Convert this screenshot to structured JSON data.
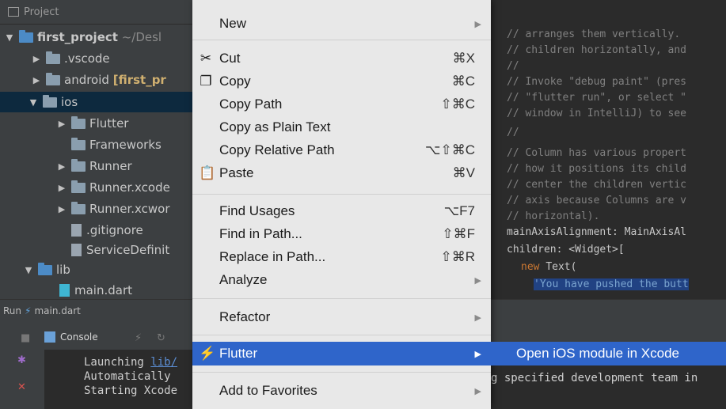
{
  "project": {
    "header": "Project",
    "tree": [
      {
        "name": "first_project",
        "suffix": "~/Desl"
      },
      {
        "name": ".vscode"
      },
      {
        "name": "android",
        "suffix": "[first_pr"
      },
      {
        "name": "ios"
      },
      {
        "name": "Flutter"
      },
      {
        "name": "Frameworks"
      },
      {
        "name": "Runner"
      },
      {
        "name": "Runner.xcode"
      },
      {
        "name": "Runner.xcwor"
      },
      {
        "name": ".gitignore"
      },
      {
        "name": "ServiceDefinit"
      },
      {
        "name": "lib"
      },
      {
        "name": "main.dart"
      }
    ]
  },
  "run_bar": {
    "run": "Run",
    "file": "main.dart"
  },
  "console": {
    "tab": "Console",
    "lines": [
      {
        "text": "Launching ",
        "link": "lib/"
      },
      {
        "text": "Automatically",
        "tail": "g specified development team in"
      },
      {
        "text": "Starting Xcode"
      }
    ]
  },
  "editor": {
    "lines": [
      "// arranges them vertically.",
      "// children horizontally, and",
      "//",
      "// Invoke \"debug paint\" (pres",
      "// \"flutter run\", or select \"",
      "// window in IntelliJ) to see",
      "//",
      "// Column has various propert",
      "// how it positions its child",
      "// center the children vertic",
      "// axis because Columns are v",
      "// horizontal).",
      "mainAxisAlignment: MainAxisAl",
      "children: <Widget>["
    ],
    "kw_new": "new",
    "text_call": "Text(",
    "string": "'You have pushed the butt"
  },
  "context_menu": {
    "items": [
      {
        "label": "New",
        "shortcut": "",
        "submenu": true
      },
      {
        "label": "Cut",
        "shortcut": "⌘X",
        "icon": "✂"
      },
      {
        "label": "Copy",
        "shortcut": "⌘C",
        "icon": "❐"
      },
      {
        "label": "Copy Path",
        "shortcut": "⇧⌘C"
      },
      {
        "label": "Copy as Plain Text",
        "shortcut": ""
      },
      {
        "label": "Copy Relative Path",
        "shortcut": "⌥⇧⌘C"
      },
      {
        "label": "Paste",
        "shortcut": "⌘V",
        "icon": "📋"
      },
      {
        "label": "Find Usages",
        "shortcut": "⌥F7"
      },
      {
        "label": "Find in Path...",
        "shortcut": "⇧⌘F"
      },
      {
        "label": "Replace in Path...",
        "shortcut": "⇧⌘R"
      },
      {
        "label": "Analyze",
        "shortcut": "",
        "submenu": true
      },
      {
        "label": "Refactor",
        "shortcut": "",
        "submenu": true
      },
      {
        "label": "Flutter",
        "shortcut": "",
        "submenu": true,
        "highlighted": true
      },
      {
        "label": "Add to Favorites",
        "shortcut": "",
        "submenu": true
      }
    ]
  },
  "submenu": {
    "label": "Open iOS module in Xcode"
  },
  "colors": {
    "highlight": "#2f65ca",
    "menu_bg": "#e8e8e8",
    "panel_bg": "#3c3f41",
    "editor_bg": "#2b2b2b"
  }
}
